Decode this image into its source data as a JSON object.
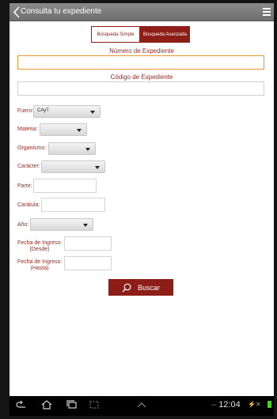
{
  "header": {
    "title": "Consulta tu expediente",
    "back_icon": "chevron-left-icon",
    "menu_icon": "hamburger-menu-icon"
  },
  "tabs": {
    "simple": "Búsqueda Simple",
    "advanced": "Búsqueda Avanzada",
    "active": "advanced"
  },
  "form": {
    "numero_label": "Número de Expediente",
    "numero_value": "",
    "codigo_label": "Código de Expediente",
    "codigo_value": "",
    "fuero_label": "Fuero:",
    "fuero_value": "CAyT",
    "materia_label": "Materia:",
    "materia_value": "",
    "organismo_label": "Organismo:",
    "organismo_value": "",
    "caracter_label": "Carácter:",
    "caracter_value": "",
    "parte_label": "Parte:",
    "parte_value": "",
    "caratula_label": "Carátula:",
    "caratula_value": "",
    "anio_label": "Año:",
    "anio_value": "",
    "desde_label_line1": "Fecha de Ingreso:",
    "desde_label_line2": "(Desde)",
    "desde_value": "",
    "hasta_label_line1": "Fecha de Ingreso:",
    "hasta_label_line2": "(Hasta)",
    "hasta_value": "",
    "search_button": "Buscar",
    "search_icon": "magnifier-icon"
  },
  "system_bar": {
    "time": "12:04",
    "battery_color": "#4bd01f"
  },
  "colors": {
    "accent": "#8c1d17",
    "label": "#9a2a22",
    "focus": "#e8962f",
    "topbar": "#7c7c7c"
  }
}
